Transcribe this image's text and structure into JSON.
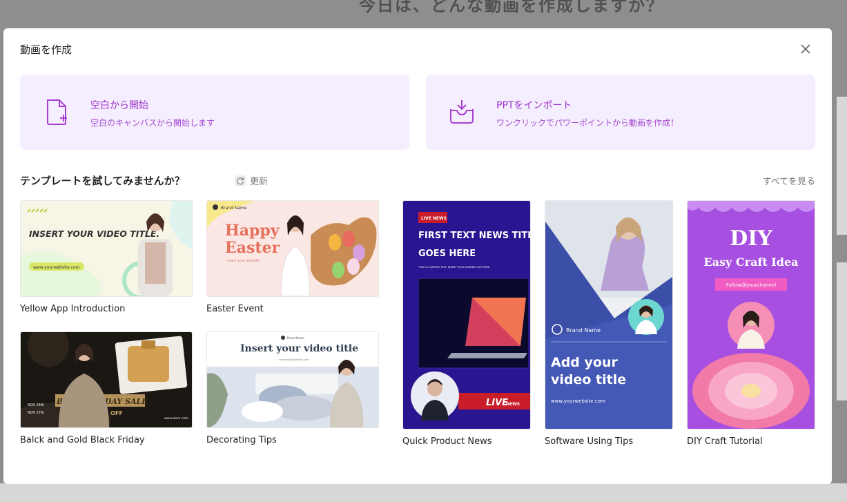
{
  "background": {
    "heading": "今日は、どんな動画を作成しますか？"
  },
  "modal": {
    "title": "動画を作成"
  },
  "actions": {
    "blank": {
      "title": "空白から開始",
      "subtitle": "空白のキャンバスから開始します",
      "icon": "new-file-icon"
    },
    "ppt": {
      "title": "PPTをインポート",
      "subtitle": "ワンクリックでパワーポイントから動画を作成！",
      "icon": "import-tray-icon"
    }
  },
  "templates_section": {
    "title": "テンプレートを試してみませんか？",
    "refresh_label": "更新",
    "see_all_label": "すべてを見る"
  },
  "templates": [
    {
      "label": "Yellow App Introduction",
      "thumb_text": "INSERT YOUR VIDEO TITLE.",
      "thumb_sub": "www.yourwebsite.com"
    },
    {
      "label": "Easter Event",
      "thumb_text1": "Happy",
      "thumb_text2": "Easter",
      "thumb_sub": "Insert your subtitle",
      "brand": "Brand Name"
    },
    {
      "label": "Balck and Gold Black Friday",
      "thumb_text": "BLACK FRIDAY SALE",
      "thumb_sub": "UP TO 50% OFF",
      "date1": "NOV 24th",
      "date2": "NOV 27th",
      "site": "www.store.com"
    },
    {
      "label": "Decorating Tips",
      "thumb_text": "Insert your video title",
      "brand": "Brand Name",
      "thumb_sub": "www.reallygreatsite.com"
    },
    {
      "label": "Quick Product News",
      "badge": "LIVE NEWS",
      "thumb_text1": "FIRST TEXT NEWS TITLE",
      "thumb_text2": "GOES HERE",
      "thumb_sub": "THIS IS A SAMPLE TEXT. INSERT YOUR DESIRED TEXT HERE.",
      "live": "LIVE",
      "news": "NEWS"
    },
    {
      "label": "Software Using Tips",
      "brand": "Brand Name",
      "thumb_text1": "Add your",
      "thumb_text2": "video title",
      "thumb_sub": "www.yourwebsite.com"
    },
    {
      "label": "DIY Craft Tutorial",
      "thumb_text1": "DIY",
      "thumb_text2": "Easy Craft Idea",
      "thumb_sub": "Follow@yourchannel"
    }
  ],
  "colors": {
    "accent": "#9b32c9",
    "card_bg": "#f5eefe",
    "overlay": "#8e8e8e"
  }
}
